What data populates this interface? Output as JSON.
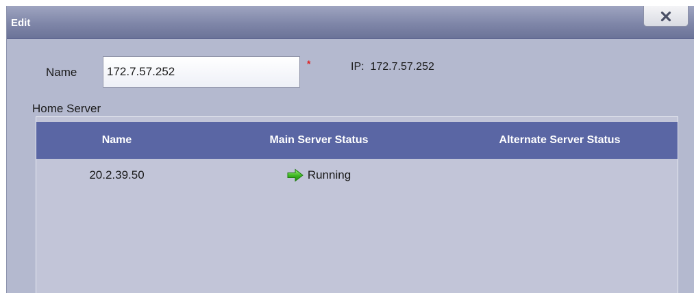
{
  "dialog": {
    "title": "Edit",
    "close_icon": "close-icon"
  },
  "form": {
    "name_label": "Name",
    "name_value": "172.7.57.252",
    "required_marker": "*",
    "ip_text": "IP:  172.7.57.252"
  },
  "home_server": {
    "label": "Home Server",
    "columns": [
      "Name",
      "Main Server Status",
      "Alternate Server Status"
    ],
    "rows": [
      {
        "name": "20.2.39.50",
        "main_status": "Running",
        "main_status_icon": "green-arrow-icon",
        "alternate_status": ""
      }
    ]
  },
  "colors": {
    "title_bar": "#7f86a8",
    "dialog_background": "#b4b9cf",
    "grid_header": "#5a66a4",
    "grid_background": "#c2c5d8",
    "required_marker": "#e02020",
    "status_running": "#3cb521"
  }
}
